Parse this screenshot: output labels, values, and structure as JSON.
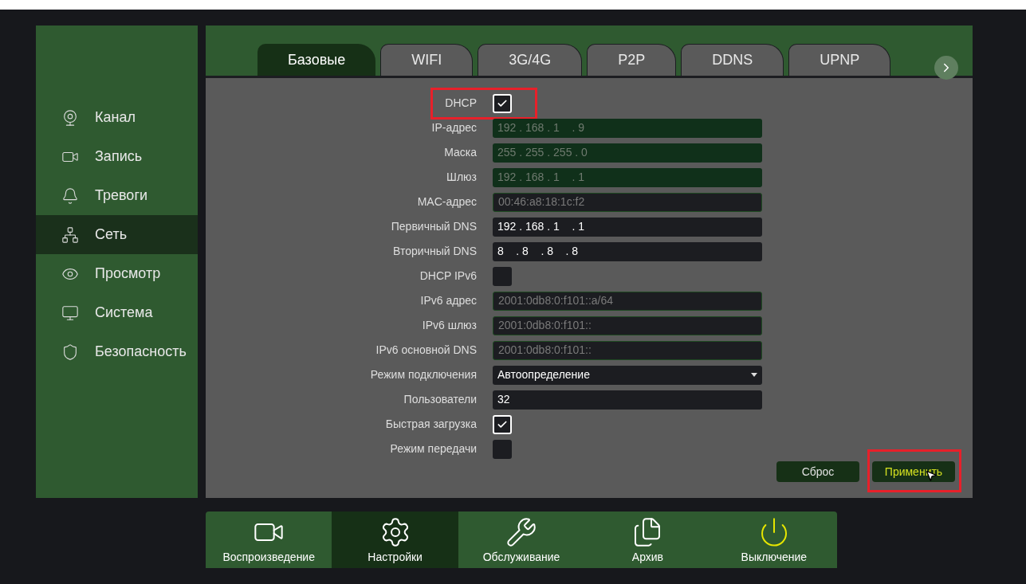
{
  "sidebar": {
    "items": [
      {
        "label": "Канал",
        "selected": false
      },
      {
        "label": "Запись",
        "selected": false
      },
      {
        "label": "Тревоги",
        "selected": false
      },
      {
        "label": "Сеть",
        "selected": true
      },
      {
        "label": "Просмотр",
        "selected": false
      },
      {
        "label": "Система",
        "selected": false
      },
      {
        "label": "Безопасность",
        "selected": false
      }
    ]
  },
  "tabs": [
    {
      "label": "Базовые",
      "selected": true
    },
    {
      "label": "WIFI",
      "selected": false
    },
    {
      "label": "3G/4G",
      "selected": false
    },
    {
      "label": "P2P",
      "selected": false
    },
    {
      "label": "DDNS",
      "selected": false
    },
    {
      "label": "UPNP",
      "selected": false
    }
  ],
  "form": {
    "rows": [
      {
        "label": "DHCP",
        "kind": "checkbox",
        "checked": true,
        "highlighted": true
      },
      {
        "label": "IP-адрес",
        "kind": "ip",
        "value": "192 . 168 . 1    . 9",
        "disabled": true,
        "highlighted": false
      },
      {
        "label": "Маска",
        "kind": "ip",
        "value": "255 . 255 . 255 . 0",
        "disabled": true,
        "highlighted": false
      },
      {
        "label": "Шлюз",
        "kind": "ip",
        "value": "192 . 168 . 1    . 1",
        "disabled": true,
        "highlighted": false
      },
      {
        "label": "MAC-адрес",
        "kind": "text",
        "value": "00:46:a8:18:1c:f2",
        "disabled": true,
        "highlighted": false
      },
      {
        "label": "Первичный DNS",
        "kind": "ip",
        "value": "192 . 168 . 1    . 1",
        "disabled": false,
        "highlighted": false
      },
      {
        "label": "Вторичный DNS",
        "kind": "ip",
        "value": "8    . 8    . 8    . 8",
        "disabled": false,
        "highlighted": false
      },
      {
        "label": "DHCP IPv6",
        "kind": "checkbox",
        "checked": false,
        "highlighted": false
      },
      {
        "label": "IPv6 адрес",
        "kind": "text",
        "value": "2001:0db8:0:f101::a/64",
        "disabled": true,
        "highlighted": false
      },
      {
        "label": "IPv6 шлюз",
        "kind": "text",
        "value": "2001:0db8:0:f101::",
        "disabled": true,
        "highlighted": false
      },
      {
        "label": "IPv6 основной DNS",
        "kind": "text",
        "value": "2001:0db8:0:f101::",
        "disabled": true,
        "highlighted": false
      },
      {
        "label": "Режим подключения",
        "kind": "select",
        "value": "Автоопределение",
        "highlighted": false
      },
      {
        "label": "Пользователи",
        "kind": "text",
        "value": "32",
        "disabled": false,
        "highlighted": false
      },
      {
        "label": "Быстрая загрузка",
        "kind": "checkbox",
        "checked": true,
        "highlighted": false
      },
      {
        "label": "Режим передачи",
        "kind": "checkbox",
        "checked": false,
        "highlighted": false
      }
    ],
    "buttons": [
      {
        "label": "Сброс",
        "hovered": false,
        "highlighted": false
      },
      {
        "label": "Применить",
        "hovered": true,
        "highlighted": true
      }
    ]
  },
  "bottom_nav": [
    {
      "label": "Воспроизведение",
      "selected": false
    },
    {
      "label": "Настройки",
      "selected": true
    },
    {
      "label": "Обслуживание",
      "selected": false
    },
    {
      "label": "Архив",
      "selected": false
    },
    {
      "label": "Выключение",
      "selected": false
    }
  ]
}
